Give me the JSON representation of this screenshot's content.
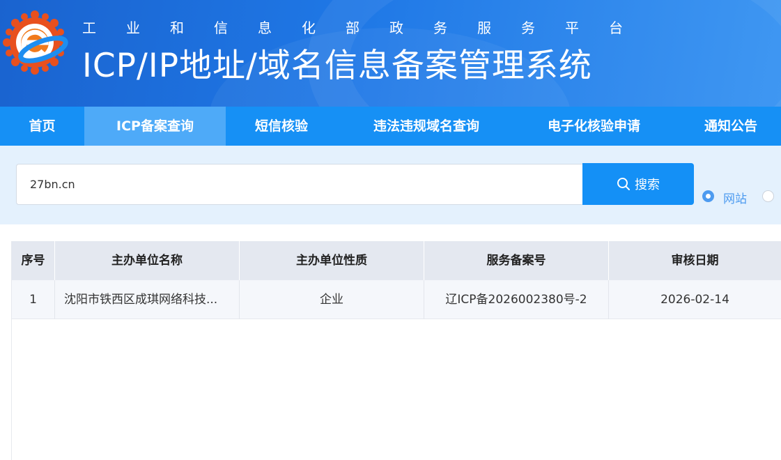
{
  "header": {
    "subtitle": "工业和信息化部政务服务平台",
    "title": "ICP/IP地址/域名信息备案管理系统"
  },
  "nav": {
    "items": [
      {
        "label": "首页"
      },
      {
        "label": "ICP备案查询",
        "active": true
      },
      {
        "label": "短信核验"
      },
      {
        "label": "违法违规域名查询"
      },
      {
        "label": "电子化核验申请"
      },
      {
        "label": "通知公告"
      }
    ]
  },
  "search": {
    "value": "27bn.cn",
    "button_label": "搜索",
    "radio_options": [
      {
        "label": "网站",
        "checked": true
      },
      {
        "label": "",
        "checked": false
      }
    ]
  },
  "table": {
    "columns": [
      "序号",
      "主办单位名称",
      "主办单位性质",
      "服务备案号",
      "审核日期"
    ],
    "rows": [
      [
        "1",
        "沈阳市铁西区成琪网络科技...",
        "企业",
        "辽ICP备2026002380号-2",
        "2026-02-14"
      ]
    ]
  },
  "colors": {
    "nav_bg": "#1690f5",
    "nav_active": "#4eaaf8",
    "button_blue": "#1490f6",
    "search_band": "#e4f1fd"
  }
}
